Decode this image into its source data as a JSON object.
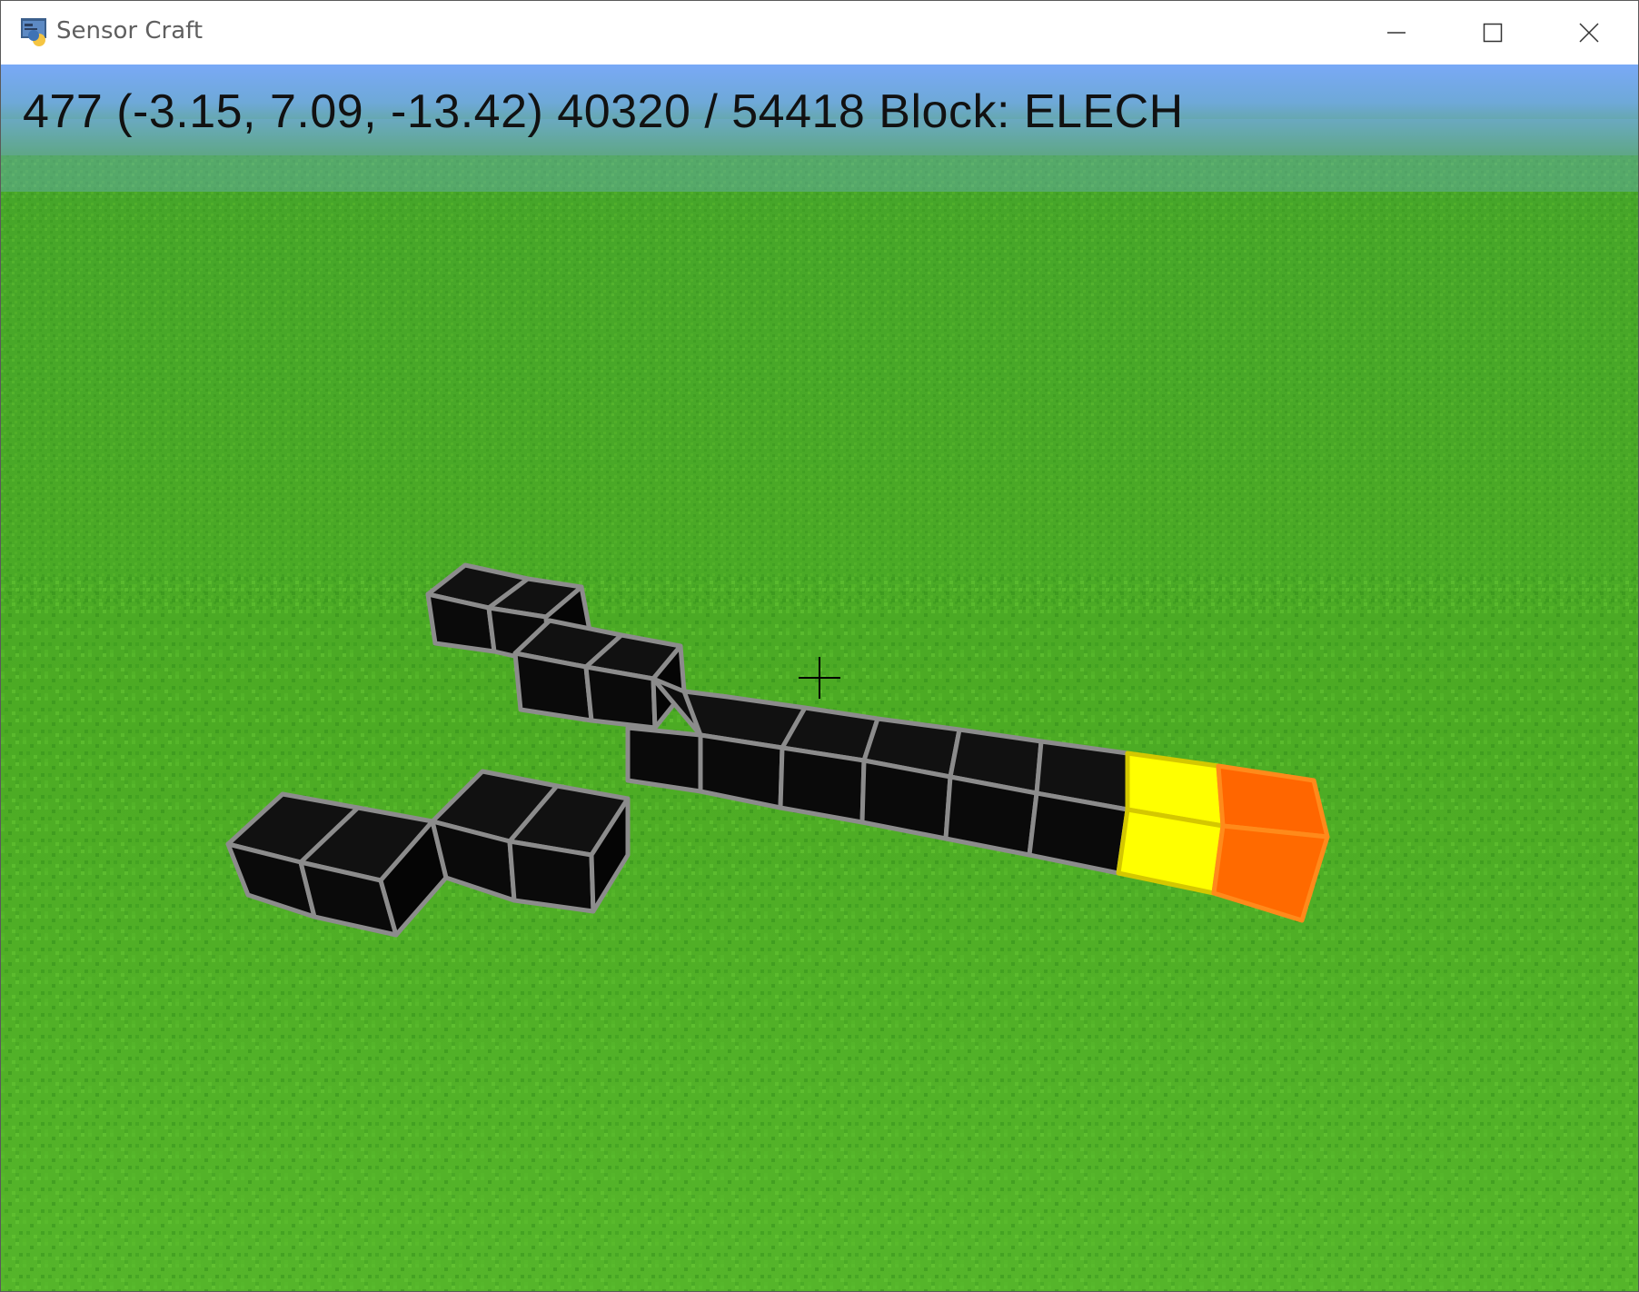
{
  "window": {
    "title": "Sensor Craft",
    "controls": {
      "minimize": "minimize-icon",
      "maximize": "maximize-icon",
      "close": "close-icon"
    }
  },
  "hud": {
    "fps": "477",
    "position": "(-3.15, 7.09, -13.42)",
    "counts": "40320 / 54418",
    "block_label": "Block:",
    "block_name": "ELECH"
  },
  "colors": {
    "sky": "#7aaaf5",
    "grass": "#4aa822",
    "block_black": "#0a0a0a",
    "block_edge": "#8a8a8a",
    "block_yellow": "#ffff00",
    "block_orange": "#ff6a00"
  }
}
